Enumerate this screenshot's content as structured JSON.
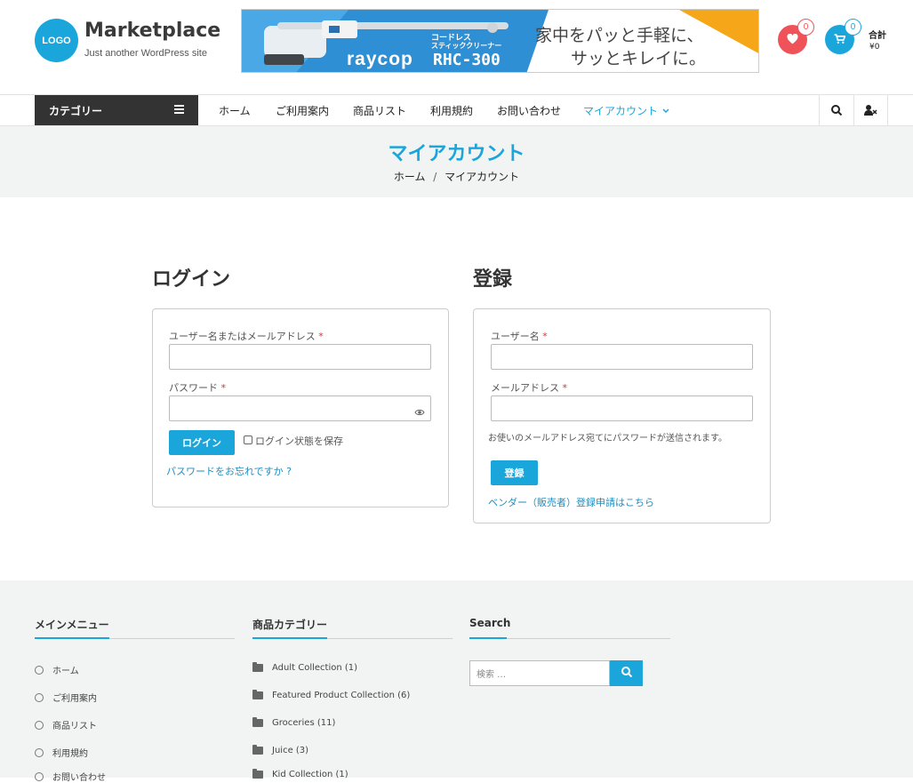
{
  "header": {
    "logo_text": "LOGO",
    "site_title": "Marketplace",
    "tagline": "Just another WordPress site",
    "banner": {
      "sub1": "コードレス",
      "sub2": "スティッククリーナー",
      "brand": "raycop",
      "model": "RHC-300",
      "copy1": "家中をパッと手軽に、",
      "copy2": "サッとキレイに。"
    },
    "wishlist_count": "0",
    "cart_count": "0",
    "total_label": "合計",
    "total_value": "¥0"
  },
  "nav": {
    "category_label": "カテゴリー",
    "items": [
      "ホーム",
      "ご利用案内",
      "商品リスト",
      "利用規約",
      "お問い合わせ",
      "マイアカウント"
    ]
  },
  "page": {
    "title": "マイアカウント",
    "breadcrumb_home": "ホーム",
    "breadcrumb_sep": "/",
    "breadcrumb_current": "マイアカウント"
  },
  "login": {
    "heading": "ログイン",
    "username_label": "ユーザー名またはメールアドレス",
    "password_label": "パスワード",
    "required_mark": "*",
    "button": "ログイン",
    "remember_label": "ログイン状態を保存",
    "lost_password": "パスワードをお忘れですか ?"
  },
  "register": {
    "heading": "登録",
    "username_label": "ユーザー名",
    "email_label": "メールアドレス",
    "required_mark": "*",
    "note": "お使いのメールアドレス宛てにパスワードが送信されます。",
    "button": "登録",
    "vendor_link": "ベンダー（販売者）登録申請はこちら"
  },
  "footer": {
    "menu_heading": "メインメニュー",
    "menu_items": [
      "ホーム",
      "ご利用案内",
      "商品リスト",
      "利用規約",
      "お問い合わせ"
    ],
    "cat_heading": "商品カテゴリー",
    "cat_items": [
      "Adult Collection (1)",
      "Featured Product Collection (6)",
      "Groceries (11)",
      "Juice (3)",
      "Kid Collection (1)"
    ],
    "search_heading": "Search",
    "search_placeholder": "検索 …"
  },
  "colors": {
    "accent": "#1aa6db",
    "wishlist": "#f0525a",
    "dark": "#333333"
  }
}
